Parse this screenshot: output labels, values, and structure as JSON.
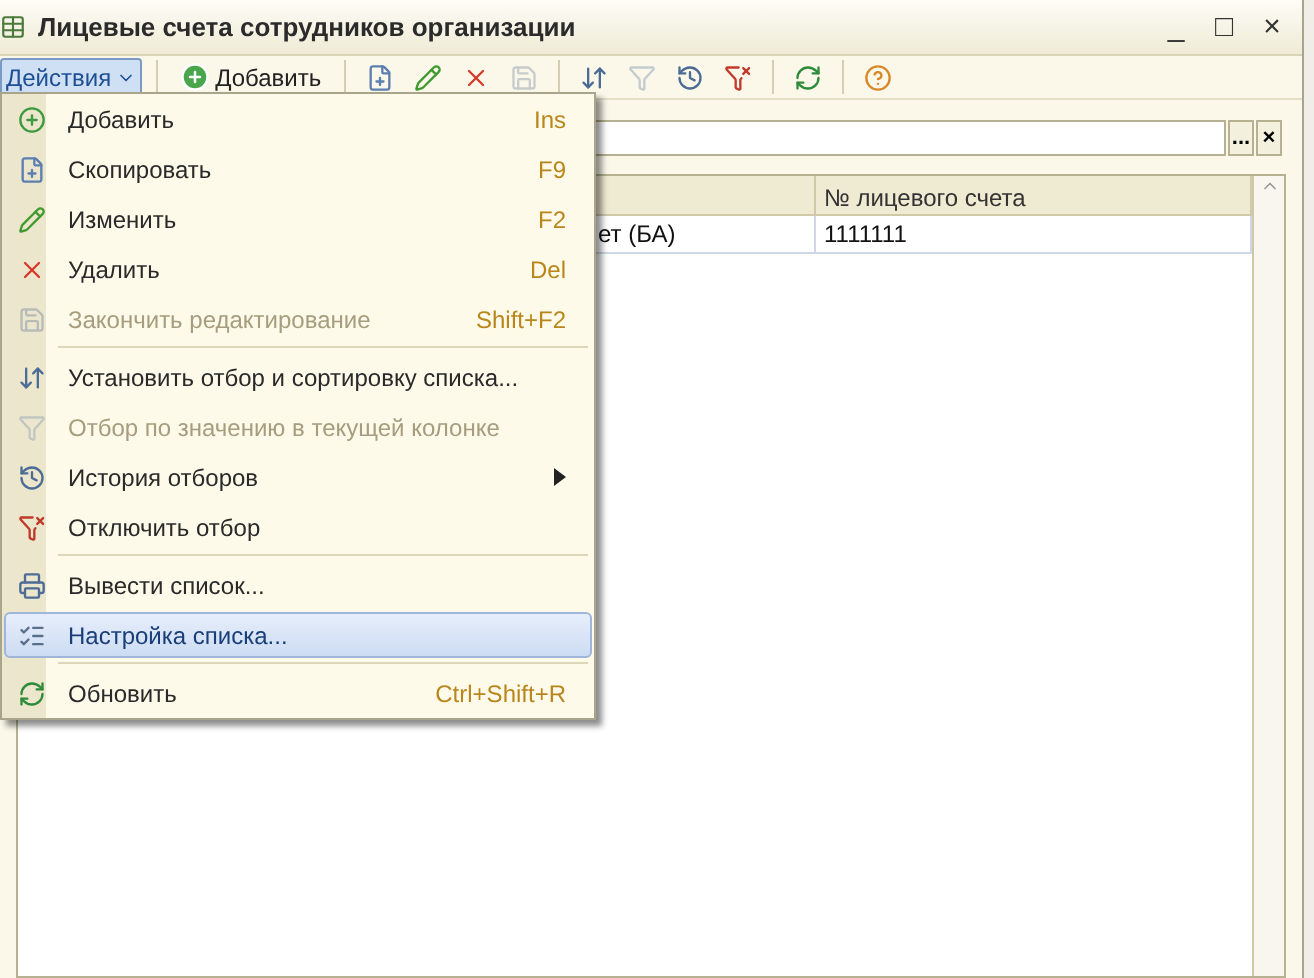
{
  "window": {
    "title": "Лицевые счета сотрудников организации",
    "controls": [
      "_",
      "□",
      "×"
    ]
  },
  "toolbar": {
    "actions": {
      "label": "Действия",
      "open": true
    },
    "add": {
      "label": "Добавить"
    },
    "tools": [
      {
        "disabled": false
      },
      {
        "disabled": false
      },
      {
        "disabled": false
      },
      {
        "disabled": true
      },
      {
        "disabled": false
      },
      {
        "disabled": true
      },
      {
        "disabled": false
      },
      {
        "disabled": false
      },
      {
        "disabled": false
      },
      {
        "disabled": false
      }
    ]
  },
  "filter": {
    "buttons": [
      "...",
      "×"
    ]
  },
  "table": {
    "columns": [
      {},
      {
        "label": "№ лицевого счета"
      }
    ],
    "rows": [
      {
        "cells": [
          "ет (БА)",
          "1111111"
        ]
      }
    ]
  },
  "menu": {
    "items": [
      {
        "kind": "item",
        "label": "Добавить",
        "shortcut": "Ins",
        "disabled": false,
        "selected": false
      },
      {
        "kind": "item",
        "label": "Скопировать",
        "shortcut": "F9",
        "disabled": false,
        "selected": false
      },
      {
        "kind": "item",
        "label": "Изменить",
        "shortcut": "F2",
        "disabled": false,
        "selected": false
      },
      {
        "kind": "item",
        "label": "Удалить",
        "shortcut": "Del",
        "disabled": false,
        "selected": false
      },
      {
        "kind": "item",
        "label": "Закончить редактирование",
        "shortcut": "Shift+F2",
        "disabled": true,
        "selected": false
      },
      {
        "kind": "separator"
      },
      {
        "kind": "item",
        "label": "Установить отбор и сортировку списка...",
        "disabled": false,
        "selected": false
      },
      {
        "kind": "item",
        "label": "Отбор по значению в текущей колонке",
        "disabled": true,
        "selected": false
      },
      {
        "kind": "submenu",
        "label": "История отборов",
        "disabled": false,
        "selected": false
      },
      {
        "kind": "item",
        "label": "Отключить отбор",
        "disabled": false,
        "selected": false
      },
      {
        "kind": "separator"
      },
      {
        "kind": "item",
        "label": "Вывести список...",
        "disabled": false,
        "selected": false
      },
      {
        "kind": "item",
        "label": "Настройка списка...",
        "disabled": false,
        "selected": true
      },
      {
        "kind": "separator"
      },
      {
        "kind": "item",
        "label": "Обновить",
        "shortcut": "Ctrl+Shift+R",
        "disabled": false,
        "selected": false
      }
    ]
  }
}
